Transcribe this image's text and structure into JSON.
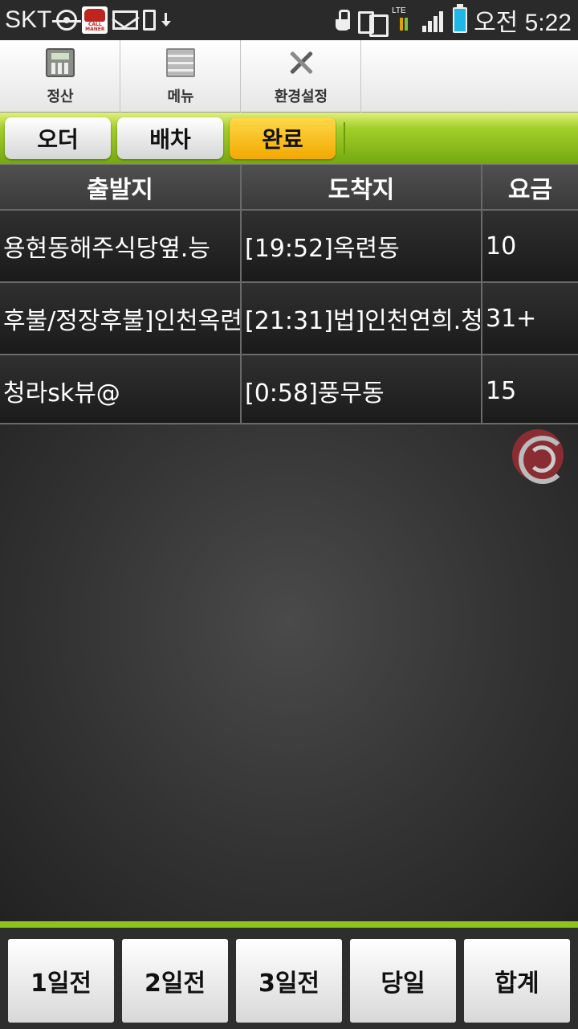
{
  "status_bar": {
    "carrier": "SKT",
    "network_label": "LTE",
    "time": "오전 5:22",
    "icons": [
      "gps-icon",
      "callmaner-app-icon",
      "gmail-icon",
      "phone-download-icon",
      "download-arrow-icon",
      "touch-hand-icon",
      "devices-icon",
      "lte-data-icon",
      "signal-icon",
      "battery-icon"
    ],
    "callmaner_text": "CALL MANER"
  },
  "top_menu": {
    "items": [
      {
        "label": "정산",
        "icon": "calculator-icon"
      },
      {
        "label": "메뉴",
        "icon": "menu-list-icon"
      },
      {
        "label": "환경설정",
        "icon": "tools-icon"
      }
    ]
  },
  "tabs": [
    {
      "label": "오더",
      "active": false
    },
    {
      "label": "배차",
      "active": false
    },
    {
      "label": "완료",
      "active": true
    }
  ],
  "table": {
    "headers": [
      "출발지",
      "도착지",
      "요금"
    ],
    "rows": [
      {
        "origin": "용현동해주식당옆.능",
        "destination": "[19:52]옥련동",
        "fare": "10"
      },
      {
        "origin": "후불/정장후불]인천옥련",
        "destination": "[21:31]법]인천연희.청",
        "fare": "31+"
      },
      {
        "origin": "청라sk뷰@",
        "destination": "[0:58]풍무동",
        "fare": "15"
      }
    ]
  },
  "bottom_buttons": [
    "1일전",
    "2일전",
    "3일전",
    "당일",
    "합계"
  ],
  "colors": {
    "accent_green": "#8fc21d",
    "active_tab": "#f2a900",
    "row_background": "#262626"
  }
}
